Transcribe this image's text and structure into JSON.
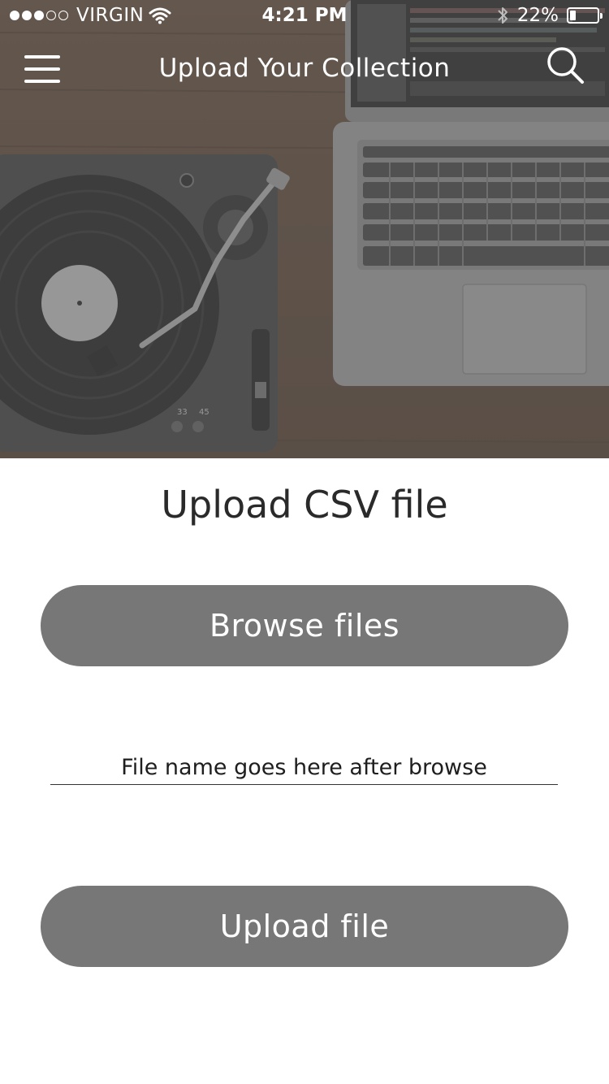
{
  "status_bar": {
    "carrier": "VIRGIN",
    "time": "4:21 PM",
    "battery_text": "22%",
    "battery_level": 0.22,
    "signal_filled": 3,
    "signal_total": 5
  },
  "nav": {
    "title": "Upload Your Collection",
    "menu_icon": "hamburger-menu-icon",
    "search_icon": "search-icon"
  },
  "hero": {
    "description_icon": "turntable-and-laptop-photo"
  },
  "main": {
    "heading": "Upload CSV file",
    "browse_label": "Browse files",
    "file_name_placeholder": "File name goes here after browse",
    "upload_label": "Upload file"
  },
  "colors": {
    "button_bg": "#777777",
    "button_text": "#ffffff",
    "heading": "#2a2a2a"
  }
}
